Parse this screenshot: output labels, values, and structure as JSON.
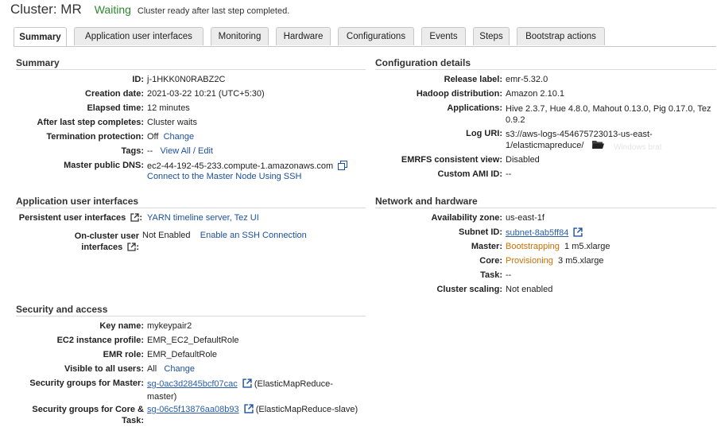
{
  "header": {
    "title": "Cluster: MR",
    "status": "Waiting",
    "status_message": "Cluster ready after last step completed."
  },
  "tabs": [
    {
      "label": "Summary",
      "active": true
    },
    {
      "label": "Application user interfaces",
      "active": false
    },
    {
      "label": "Monitoring",
      "active": false
    },
    {
      "label": "Hardware",
      "active": false
    },
    {
      "label": "Configurations",
      "active": false
    },
    {
      "label": "Events",
      "active": false
    },
    {
      "label": "Steps",
      "active": false
    },
    {
      "label": "Bootstrap actions",
      "active": false
    }
  ],
  "summary": {
    "title": "Summary",
    "id_label": "ID:",
    "id_value": "j-1HKK0N0RABZ2C",
    "creation_label": "Creation date:",
    "creation_value": "2021-03-22 10:21 (UTC+5:30)",
    "elapsed_label": "Elapsed time:",
    "elapsed_value": "12 minutes",
    "after_step_label": "After last step completes:",
    "after_step_value": "Cluster waits",
    "termination_label": "Termination protection:",
    "termination_value": "Off",
    "termination_link": "Change",
    "tags_label": "Tags:",
    "tags_value": "--",
    "tags_link": "View All / Edit",
    "dns_label": "Master public DNS:",
    "dns_value": "ec2-44-192-45-233.compute-1.amazonaws.com",
    "ssh_link": "Connect to the Master Node Using SSH"
  },
  "config": {
    "title": "Configuration details",
    "release_label": "Release label:",
    "release_value": "emr-5.32.0",
    "hadoop_label": "Hadoop distribution:",
    "hadoop_value": "Amazon 2.10.1",
    "apps_label": "Applications:",
    "apps_value": "Hive 2.3.7, Hue 4.8.0, Mahout 0.13.0, Pig 0.17.0, Tez 0.9.2",
    "log_label": "Log URI:",
    "log_value": "s3://aws-logs-454675723013-us-east-1/elasticmapreduce/",
    "emrfs_label": "EMRFS consistent view:",
    "emrfs_value": "Disabled",
    "ami_label": "Custom AMI ID:",
    "ami_value": "--",
    "ghost_text": "Windows brat"
  },
  "app_ui": {
    "title": "Application user interfaces",
    "persistent_label": "Persistent user interfaces",
    "persistent_value": "YARN timeline server, Tez UI",
    "oncluster_label": "On-cluster user interfaces",
    "oncluster_value": "Not Enabled",
    "oncluster_link": "Enable an SSH Connection"
  },
  "network": {
    "title": "Network and hardware",
    "az_label": "Availability zone:",
    "az_value": "us-east-1f",
    "subnet_label": "Subnet ID:",
    "subnet_value": "subnet-8ab5ff84",
    "master_label": "Master:",
    "master_status": "Bootstrapping",
    "master_value": "1  m5.xlarge",
    "core_label": "Core:",
    "core_status": "Provisioning",
    "core_value": "3  m5.xlarge",
    "task_label": "Task:",
    "task_value": "--",
    "scaling_label": "Cluster scaling:",
    "scaling_value": "Not enabled"
  },
  "security": {
    "title": "Security and access",
    "key_label": "Key name:",
    "key_value": "mykeypair2",
    "ec2_label": "EC2 instance profile:",
    "ec2_value": "EMR_EC2_DefaultRole",
    "role_label": "EMR role:",
    "role_value": "EMR_DefaultRole",
    "visible_label": "Visible to all users:",
    "visible_value": "All",
    "visible_link": "Change",
    "sg_master_label": "Security groups for Master:",
    "sg_master_link": "sg-0ac3d2845bcf07cac",
    "sg_master_name": "(ElasticMapReduce-master)",
    "sg_core_label": "Security groups for Core & Task:",
    "sg_core_link": "sg-06c5f13876aa08b93",
    "sg_core_name": "(ElasticMapReduce-slave)"
  },
  "colors": {
    "status_green": "#2d8a2d",
    "link_blue": "#1a4f9e",
    "warning_orange": "#d06e00"
  }
}
